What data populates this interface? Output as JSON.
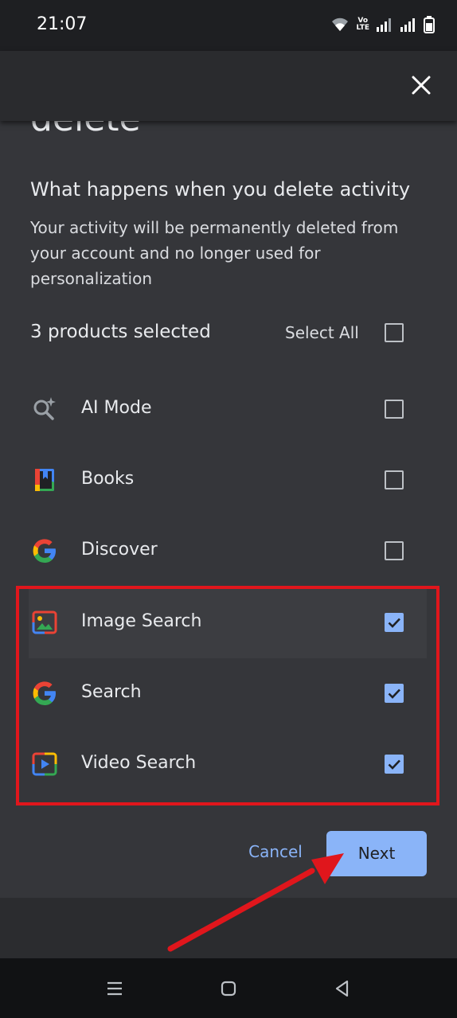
{
  "status_bar": {
    "time": "21:07",
    "icons": [
      "wifi-icon",
      "volte-icon",
      "signal-icon",
      "signal-icon",
      "battery-icon"
    ],
    "volte_top": "Vo",
    "volte_bottom": "LTE"
  },
  "header": {
    "close_icon": "close-icon",
    "clipped_title": "delete"
  },
  "info": {
    "title": "What happens when you delete activity",
    "description": "Your activity will be permanently deleted from your account and no longer used for personalization"
  },
  "selection": {
    "count_label": "3 products selected",
    "select_all_label": "Select All",
    "select_all_checked": false
  },
  "products": [
    {
      "label": "AI Mode",
      "icon": "ai-mode-icon",
      "checked": false
    },
    {
      "label": "Books",
      "icon": "books-icon",
      "checked": false
    },
    {
      "label": "Discover",
      "icon": "google-icon",
      "checked": false
    },
    {
      "label": "Image Search",
      "icon": "image-search-icon",
      "checked": true
    },
    {
      "label": "Search",
      "icon": "google-icon",
      "checked": true
    },
    {
      "label": "Video Search",
      "icon": "video-search-icon",
      "checked": true
    }
  ],
  "actions": {
    "cancel_label": "Cancel",
    "next_label": "Next"
  },
  "colors": {
    "accent": "#8ab4f8",
    "annotation_red": "#e0161c",
    "sheet_bg": "#35363a"
  },
  "nav_bar": {
    "icons": [
      "menu-icon",
      "home-icon",
      "back-icon"
    ]
  }
}
